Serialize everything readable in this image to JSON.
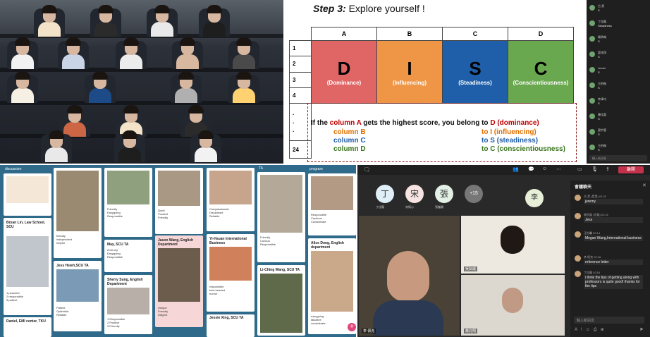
{
  "slide": {
    "step": "Step 3:",
    "title": " Explore yourself !",
    "columns": [
      "A",
      "B",
      "C",
      "D"
    ],
    "row_nums": [
      "1",
      "2",
      "3",
      "4",
      ".",
      ".",
      ".",
      "24"
    ],
    "letters": [
      "D",
      "I",
      "S",
      "C"
    ],
    "labels": [
      "(Dominance)",
      "(Influencing)",
      "(Steadiness)",
      "(Conscientiousness)"
    ],
    "colors": [
      "#e06666",
      "#ef9646",
      "#1f5ea8",
      "#6aa84f"
    ],
    "rule": {
      "lead": "If the ",
      "colA": "column A",
      "mid": " gets the highest score, you belong to ",
      "resA": "D (dominance)",
      "colB": "column B",
      "resB": "to I (influencing)",
      "colC": "column C",
      "resC": "to S (steadiness)",
      "colD": "column D",
      "resD": "to C (conscientiousness)"
    }
  },
  "chat_panel": {
    "input_placeholder": "輸入新訊息",
    "messages": [
      {
        "name": "古 昊",
        "text": "S"
      },
      {
        "name": "丁佳龍",
        "text": "Steadiness"
      },
      {
        "name": "楊承翰",
        "text": "S"
      },
      {
        "name": "蕭兆翔",
        "text": "S"
      },
      {
        "name": "Jessie",
        "text": "S"
      },
      {
        "name": "王柏翰",
        "text": "S"
      },
      {
        "name": "李偉均",
        "text": "S"
      },
      {
        "name": "陳佳嘉",
        "text": "S"
      },
      {
        "name": "蕭宇蓉",
        "text": "S"
      },
      {
        "name": "王柏翰",
        "text": "S"
      }
    ]
  },
  "board": {
    "col1": {
      "header": "discussion",
      "card1_title": "Bryan Lin, Law School, SCU",
      "card1_text": "1.peaceful\n2.responsible\n3.patient",
      "card2_title": "Daniel, EMI center, TKU"
    },
    "col2": {
      "card1_text": "friendly\nindependent\nhelpful",
      "card2_title": "Jess Hsieh,SCU TA",
      "card2_text": "Patient\nOptimistic\nReliable"
    },
    "col3": {
      "card1_text": "Friendly\nEasygoing\nResponsible",
      "card2_title": "May, SCU TA",
      "card2_text": "A bit shy\nEasygoing\nResponsible",
      "card3_title": "Sherry Sung, English Department",
      "card3_text": "1.Responsible\n2.Positive\n3.Friendly"
    },
    "col4": {
      "card1_text": "Quiet\nPrudent\nFriendly",
      "card2_title": "Jason Wang, English Department",
      "card2_text": "Unique\nFriendly\nDiligent"
    },
    "col5": {
      "card1_text": "Compassionate\nDisciplined\nReliable",
      "card2_title": "Yi-Hsuan International Business",
      "card2_text": "responsible\nkind-hearted\nhumor",
      "card3_title": "Jessie Xing, SCU TA"
    },
    "col6": {
      "header": "TA",
      "card1_text": "Friendly\nCurious\nResponsible",
      "card2_title": "Li-Ching Wang, SCU TA"
    },
    "col7": {
      "header": "program",
      "card1_text": "Responsible\nCautious\nConsiderate",
      "card2_title": "Alice Dong, English department",
      "card2_text": "easygoing\ntalkative\nconsiderate"
    }
  },
  "call": {
    "participants": [
      {
        "initial": "丁",
        "name": "丁佳龍"
      },
      {
        "initial": "宋",
        "name": "宋佩心"
      },
      {
        "initial": "張",
        "name": "張繼穎"
      },
      {
        "initial": "+15",
        "name": ""
      }
    ],
    "floating_initial": "李",
    "tiles": [
      "李 佩克",
      "吳妘威",
      "蕭兆翔"
    ],
    "leave_label": "離開",
    "chat_title": "會議聊天",
    "chat_input": "輸入新訊息",
    "messages": [
      {
        "name": "古 昊 (昊昊)",
        "time": "01:21",
        "text": "jeremy"
      },
      {
        "name": "謝宗展 (宗展)",
        "time": "01:21",
        "text": "Jess"
      },
      {
        "name": "汪怡馨",
        "time": "02:14",
        "text": "Megan Wang,International business"
      },
      {
        "name": "李 佩克",
        "time": "02:16",
        "text": "reference letter"
      },
      {
        "name": "丁佳龍",
        "time": "02:16",
        "text": "i think the tips of getting along with professors is quite good! thanks for the tips"
      }
    ]
  }
}
